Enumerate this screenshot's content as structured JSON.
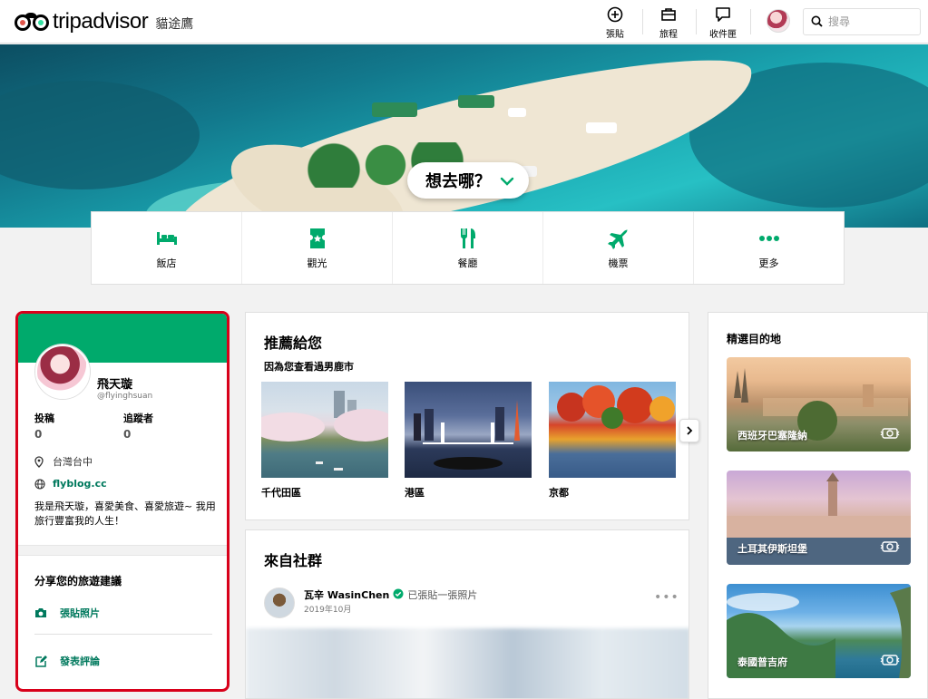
{
  "brand": {
    "logo_text": "tripadvisor",
    "sub": "貓途鷹"
  },
  "header": {
    "nav": [
      {
        "label": "張貼",
        "icon": "plus-circle-icon"
      },
      {
        "label": "旅程",
        "icon": "briefcase-icon"
      },
      {
        "label": "收件匣",
        "icon": "chat-icon"
      }
    ],
    "search_placeholder": "搜尋"
  },
  "hero": {
    "where_label": "想去哪？"
  },
  "categories": [
    {
      "label": "飯店",
      "icon": "bed-icon"
    },
    {
      "label": "觀光",
      "icon": "ticket-icon"
    },
    {
      "label": "餐廳",
      "icon": "fork-knife-icon"
    },
    {
      "label": "機票",
      "icon": "plane-icon"
    },
    {
      "label": "更多",
      "icon": "more-dots-icon"
    }
  ],
  "profile": {
    "name": "飛天璇",
    "handle": "@flyinghsuan",
    "stats": [
      {
        "label": "投稿",
        "value": "0"
      },
      {
        "label": "追蹤者",
        "value": "0"
      }
    ],
    "location": "台灣台中",
    "website": "flyblog.cc",
    "bio": "我是飛天璇，喜愛美食、喜愛旅遊~ 我用旅行豐富我的人生！",
    "share_title": "分享您的旅遊建議",
    "actions": [
      {
        "label": "張貼照片",
        "icon": "camera-icon"
      },
      {
        "label": "發表評論",
        "icon": "edit-icon"
      }
    ]
  },
  "recommend": {
    "title": "推薦給您",
    "subtitle": "因為您查看過男鹿市",
    "items": [
      {
        "label": "千代田區"
      },
      {
        "label": "港區"
      },
      {
        "label": "京都"
      }
    ]
  },
  "community": {
    "title": "來自社群",
    "post": {
      "author": "瓦辛 WasinChen",
      "action": "已張貼一張照片",
      "date": "2019年10月"
    }
  },
  "destinations": {
    "title": "精選目的地",
    "items": [
      {
        "label": "西班牙巴塞隆納"
      },
      {
        "label": "土耳其伊斯坦堡"
      },
      {
        "label": "泰國普吉府"
      }
    ]
  },
  "colors": {
    "accent": "#00aa6c",
    "link": "#00795d",
    "highlight_border": "#d8001a"
  }
}
